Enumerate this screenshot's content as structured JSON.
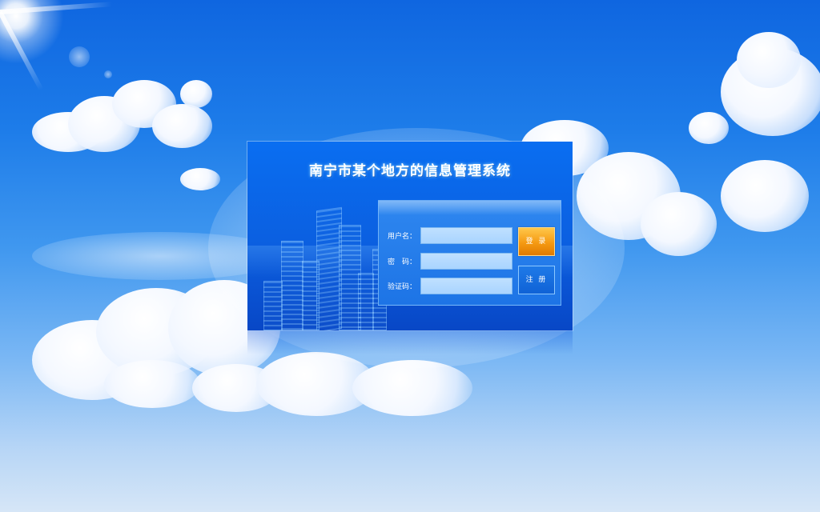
{
  "app": {
    "title": "南宁市某个地方的信息管理系统"
  },
  "login_form": {
    "username_label": "用户名：",
    "username_value": "",
    "password_label": "密　码：",
    "password_value": "",
    "captcha_label": "验证码：",
    "captcha_value": "",
    "login_button": "登 录",
    "register_button": "注 册"
  },
  "colors": {
    "sky_top": "#0f66e0",
    "panel": "#0b5fe0",
    "login_button": "#f59a12",
    "register_button": "#0f62d6",
    "field": "#a9d4ff"
  },
  "icons": {
    "background": "sky-clouds-background",
    "sun": "sun-icon",
    "buildings": "city-buildings-illustration"
  }
}
